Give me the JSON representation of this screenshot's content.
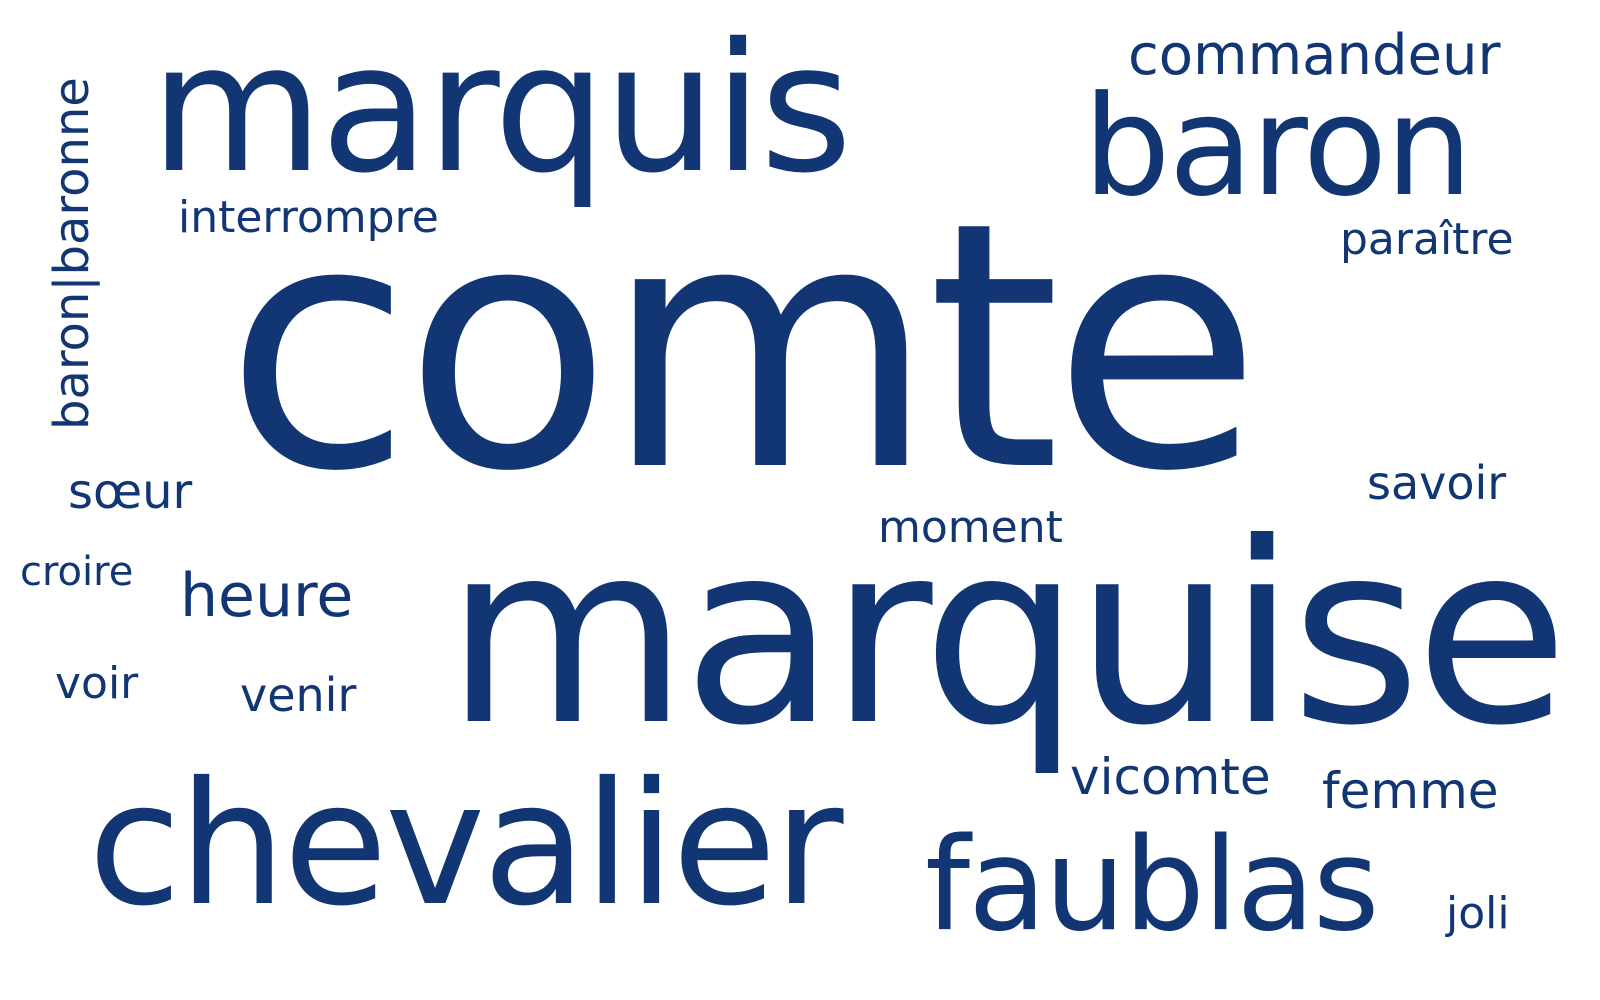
{
  "style": {
    "text_color": "#123673",
    "background": "#ffffff"
  },
  "words": {
    "comte": "comte",
    "marquise": "marquise",
    "marquis": "marquis",
    "chevalier": "chevalier",
    "baron": "baron",
    "faublas": "faublas",
    "commandeur": "commandeur",
    "heure": "heure",
    "interrompre": "interrompre",
    "paraitre": "paraître",
    "savoir": "savoir",
    "soeur": "sœur",
    "moment": "moment",
    "croire": "croire",
    "voir": "voir",
    "venir": "venir",
    "vicomte": "vicomte",
    "femme": "femme",
    "joli": "joli",
    "baron_baronne": "baron|baronne"
  }
}
